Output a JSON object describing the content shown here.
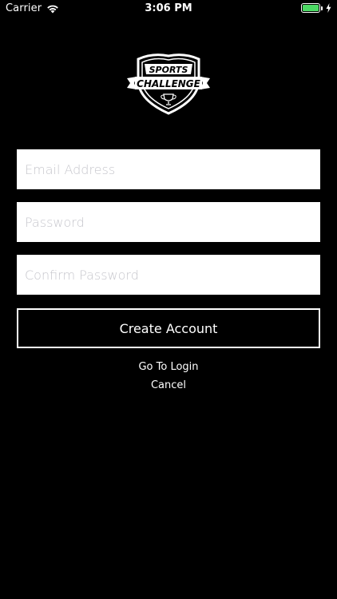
{
  "status_bar": {
    "carrier": "Carrier",
    "time": "3:06 PM",
    "wifi_icon": "wifi-icon",
    "battery_icon": "battery-icon",
    "charging_icon": "charging-bolt-icon",
    "battery_color": "#4cd964",
    "battery_level": 1.0
  },
  "logo": {
    "top_text": "SPORTS",
    "main_text": "CHALLENGE"
  },
  "form": {
    "email_placeholder": "Email Address",
    "email_value": "",
    "password_placeholder": "Password",
    "password_value": "",
    "confirm_placeholder": "Confirm Password",
    "confirm_value": "",
    "create_label": "Create Account"
  },
  "links": {
    "login_label": "Go To Login",
    "cancel_label": "Cancel"
  },
  "colors": {
    "background": "#000000",
    "field_background": "#ffffff",
    "text": "#ffffff"
  }
}
